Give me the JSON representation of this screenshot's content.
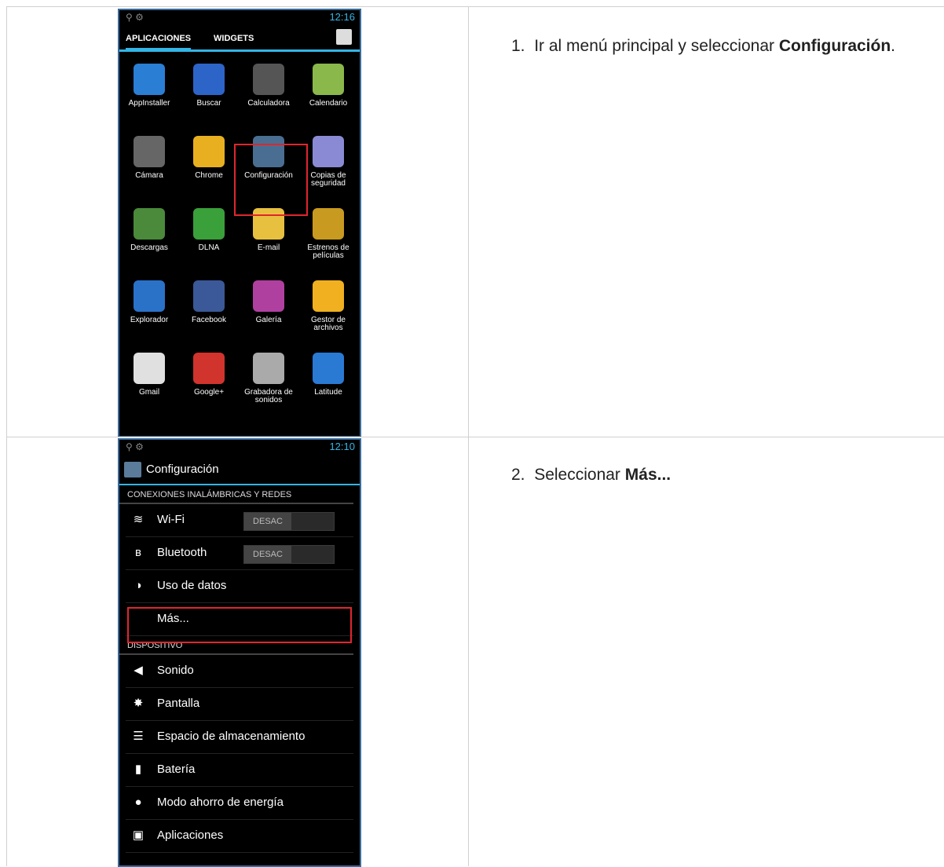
{
  "step1": {
    "number": "1.",
    "text": "Ir al menú principal y seleccionar",
    "bold": "Configuración",
    "end": "."
  },
  "step2": {
    "number": "2.",
    "text": "Seleccionar",
    "bold": "Más..."
  },
  "phone1": {
    "time": "12:16",
    "tabs": [
      "APLICACIONES",
      "WIDGETS"
    ],
    "apps": [
      {
        "label": "AppInstaller",
        "color": "#2a7fd4"
      },
      {
        "label": "Buscar",
        "color": "#2d64c8"
      },
      {
        "label": "Calculadora",
        "color": "#555555"
      },
      {
        "label": "Calendario",
        "color": "#8ab84a"
      },
      {
        "label": "Cámara",
        "color": "#666666"
      },
      {
        "label": "Chrome",
        "color": "#e8b020"
      },
      {
        "label": "Configuración",
        "color": "#4a6e92"
      },
      {
        "label": "Copias de seguridad",
        "color": "#8a8ad4"
      },
      {
        "label": "Descargas",
        "color": "#4a8a3a"
      },
      {
        "label": "DLNA",
        "color": "#3aa03a"
      },
      {
        "label": "E-mail",
        "color": "#e8c040"
      },
      {
        "label": "Estrenos de películas",
        "color": "#c89a20"
      },
      {
        "label": "Explorador",
        "color": "#2a72c8"
      },
      {
        "label": "Facebook",
        "color": "#3b5998"
      },
      {
        "label": "Galería",
        "color": "#b040a0"
      },
      {
        "label": "Gestor de archivos",
        "color": "#f0b020"
      },
      {
        "label": "Gmail",
        "color": "#e0e0e0"
      },
      {
        "label": "Google+",
        "color": "#d0342c"
      },
      {
        "label": "Grabadora de sonidos",
        "color": "#aaaaaa"
      },
      {
        "label": "Latitude",
        "color": "#2a7ad4"
      }
    ]
  },
  "phone2": {
    "time": "12:10",
    "title": "Configuración",
    "section1": "CONEXIONES INALÁMBRICAS Y REDES",
    "section2": "DISPOSITIVO",
    "items1": [
      {
        "icon": "wifi-icon",
        "label": "Wi-Fi",
        "toggle": "DESAC"
      },
      {
        "icon": "bluetooth-icon",
        "label": "Bluetooth",
        "toggle": "DESAC"
      },
      {
        "icon": "data-usage-icon",
        "label": "Uso de datos"
      },
      {
        "icon": "",
        "label": "Más..."
      }
    ],
    "items2": [
      {
        "icon": "sound-icon",
        "label": "Sonido"
      },
      {
        "icon": "display-icon",
        "label": "Pantalla"
      },
      {
        "icon": "storage-icon",
        "label": "Espacio de almacenamiento"
      },
      {
        "icon": "battery-icon",
        "label": "Batería"
      },
      {
        "icon": "power-saving-icon",
        "label": "Modo ahorro de energía"
      },
      {
        "icon": "apps-icon",
        "label": "Aplicaciones"
      }
    ]
  }
}
